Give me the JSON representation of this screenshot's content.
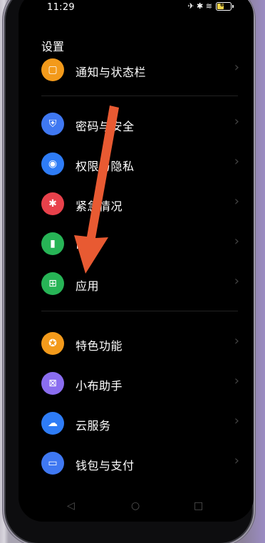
{
  "status_bar": {
    "time": "11:29",
    "signal_icons": "✈ ✱ ≋",
    "battery": "62",
    "battery_level": 0.62
  },
  "page": {
    "title": "设置"
  },
  "settings_items": [
    {
      "label": "通知与状态栏",
      "color": "#f39a1b"
    },
    {
      "label": "密码与安全",
      "color": "#3f78f2"
    },
    {
      "label": "权限与隐私",
      "color": "#2e7cf6"
    },
    {
      "label": "紧急情况",
      "color": "#e8414b"
    },
    {
      "label": "电池",
      "color": "#27b456"
    },
    {
      "label": "应用",
      "color": "#27b456"
    },
    {
      "label": "特色功能",
      "color": "#f39a1b"
    },
    {
      "label": "小布助手",
      "color": "#8a6df0"
    },
    {
      "label": "云服务",
      "color": "#2e7cf6"
    },
    {
      "label": "钱包与支付",
      "color": "#3f78f2"
    }
  ],
  "annotation": {
    "color": "#e85a32"
  }
}
